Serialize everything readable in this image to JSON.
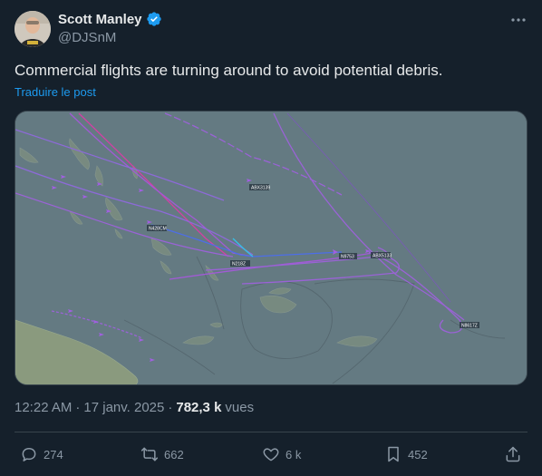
{
  "author": {
    "display_name": "Scott Manley",
    "handle": "@DJSnM",
    "verified": true,
    "avatar_icon": "avatar-photo"
  },
  "tweet": {
    "text": "Commercial flights are turning around to avoid potential debris.",
    "translate_label": "Traduire le post"
  },
  "media": {
    "type": "flight-tracker-map",
    "flight_labels": [
      "ABX3139",
      "N428CM",
      "N218Z",
      "N9753",
      "ABX5133",
      "N8617Z"
    ]
  },
  "meta": {
    "time": "12:22 AM",
    "separator": "·",
    "date": "17 janv. 2025",
    "separator2": "·",
    "views_count": "782,3 k",
    "views_label": "vues"
  },
  "actions": {
    "replies": "274",
    "reposts": "662",
    "likes": "6 k",
    "bookmarks": "452"
  },
  "colors": {
    "background": "#15202b",
    "text": "#e7e9ea",
    "muted": "#8b98a5",
    "link": "#1d9bf0",
    "verified": "#1d9bf0",
    "map_sea": "#647a82"
  }
}
